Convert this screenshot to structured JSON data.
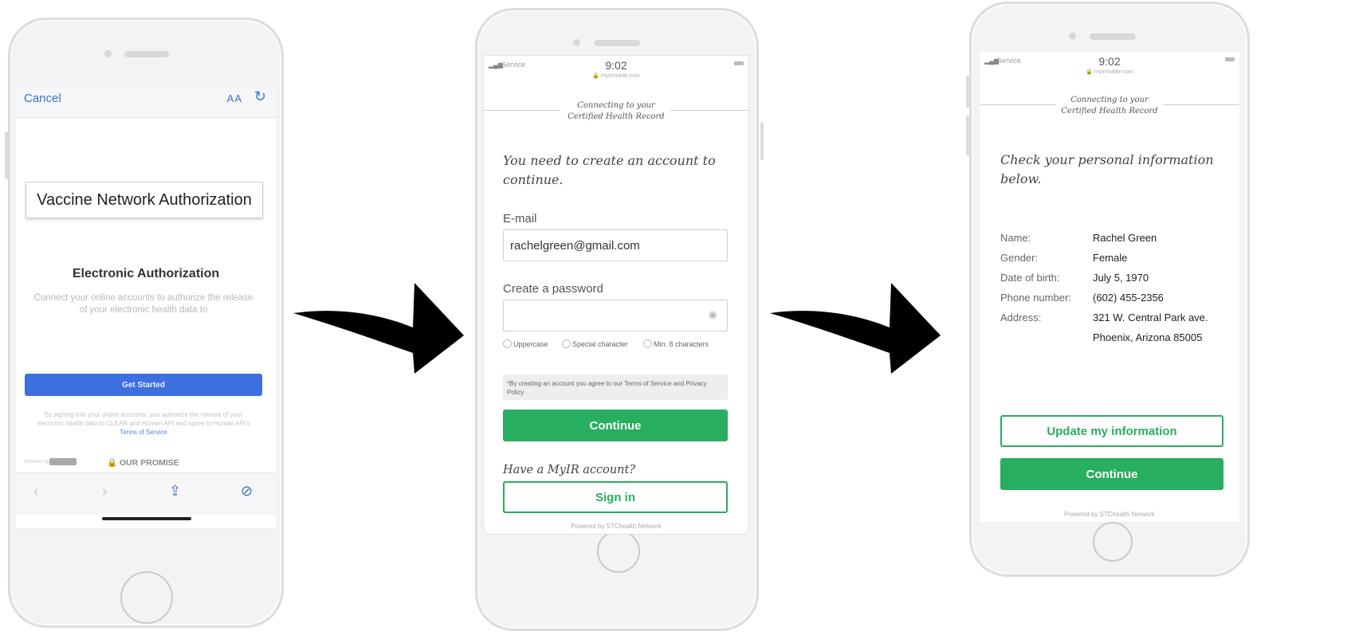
{
  "phone1": {
    "cancel_label": "Cancel",
    "text_size_label": "AA",
    "reload_icon": "reload-icon",
    "banner_text": "Vaccine Network Authorization",
    "title": "Electronic Authorization",
    "description": "Connect your online accounts to authorize the release of your electronic health data to",
    "get_started_label": "Get Started",
    "legal_text": "By signing into your online accounts, you authorize the release of your electronic health data to CLEAR and Human API and agree to Human API's",
    "legal_link": "Terms of Service",
    "powered_by": "Powered by",
    "promise_label": "OUR PROMISE"
  },
  "phone2": {
    "status_service": "Service",
    "status_time": "9:02",
    "status_url": "myirmobile.com",
    "connect_line1": "Connecting to your",
    "connect_line2": "Certified Health Record",
    "headline": "You need to create an account to continue.",
    "email_label": "E-mail",
    "email_value": "rachelgreen@gmail.com",
    "password_label": "Create a password",
    "checks": [
      "Uppercase",
      "Special character",
      "Min. 8 characters"
    ],
    "terms_text": "*By creating an account you agree to our Terms of Service and Privacy Policy",
    "continue_label": "Continue",
    "have_account": "Have a MyIR account?",
    "signin_label": "Sign in",
    "powered_by": "Powered by STChealth Network"
  },
  "phone3": {
    "status_service": "Service",
    "status_time": "9:02",
    "status_url": "myirmobile.com",
    "connect_line1": "Connecting to your",
    "connect_line2": "Certified Health Record",
    "headline": "Check your personal information below.",
    "info": [
      {
        "label": "Name:",
        "value": "Rachel Green"
      },
      {
        "label": "Gender:",
        "value": "Female"
      },
      {
        "label": "Date of birth:",
        "value": "July 5, 1970"
      },
      {
        "label": "Phone number:",
        "value": "(602) 455-2356"
      },
      {
        "label": "Address:",
        "value": "321 W. Central Park ave."
      },
      {
        "label": "",
        "value": "Phoenix, Arizona 85005"
      }
    ],
    "update_label": "Update my information",
    "continue_label": "Continue",
    "powered_by": "Powered by STChealth Network"
  },
  "colors": {
    "green": "#27ae5f",
    "blue": "#3d6fe0",
    "link_blue": "#3a73c8"
  }
}
